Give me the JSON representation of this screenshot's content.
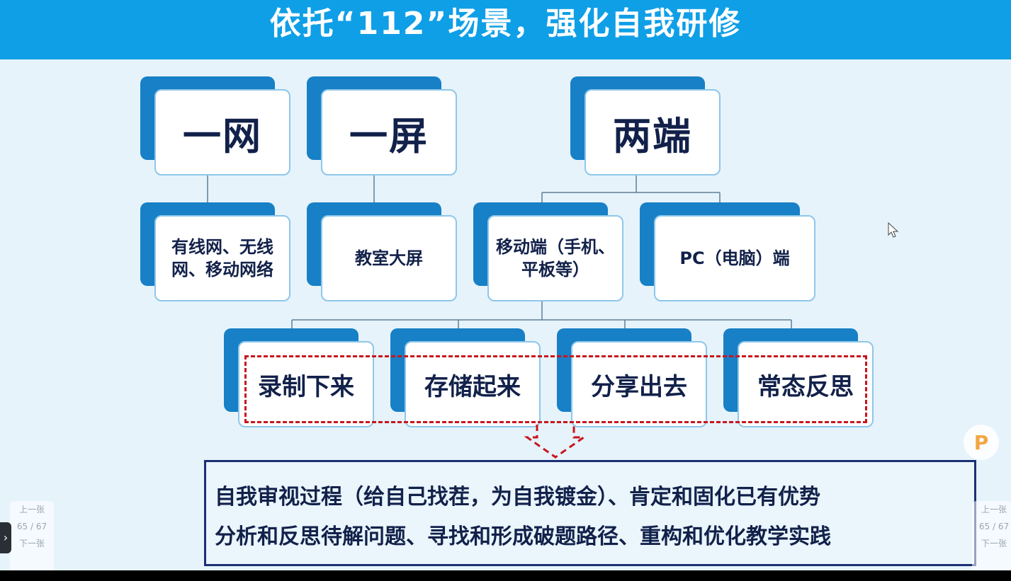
{
  "title": "依托“112”场景，强化自我研修",
  "level1": [
    {
      "id": "wang",
      "label": "一网"
    },
    {
      "id": "ping",
      "label": "一屏"
    },
    {
      "id": "duan",
      "label": "两端"
    }
  ],
  "level2": [
    {
      "id": "network",
      "lines": [
        "有线网、无线",
        "网、移动网络"
      ]
    },
    {
      "id": "screen",
      "lines": [
        "教室大屏"
      ]
    },
    {
      "id": "mobile",
      "lines": [
        "移动端（手机、",
        "平板等）"
      ]
    },
    {
      "id": "pc",
      "lines": [
        "PC（电脑）端"
      ]
    }
  ],
  "level3": [
    {
      "id": "record",
      "label": "录制下来"
    },
    {
      "id": "store",
      "label": "存储起来"
    },
    {
      "id": "share",
      "label": "分享出去"
    },
    {
      "id": "reflect",
      "label": "常态反思"
    }
  ],
  "summary": {
    "line1": "自我审视过程（给自己找茬，为自我镀金）、肯定和固化已有优势",
    "line2": "分析和反思待解问题、寻找和形成破题路径、重构和优化教学实践"
  },
  "ui": {
    "logo_letter": "P",
    "nav_prev": "上一张",
    "nav_page": "65 / 67",
    "nav_next": "下一张",
    "side_arrow": "›"
  },
  "colors": {
    "title_bg": "#0f9fe6",
    "node_back": "#1780c6",
    "node_text": "#12214a",
    "dashed": "#c8161d",
    "summary_border": "#1c2f74"
  }
}
